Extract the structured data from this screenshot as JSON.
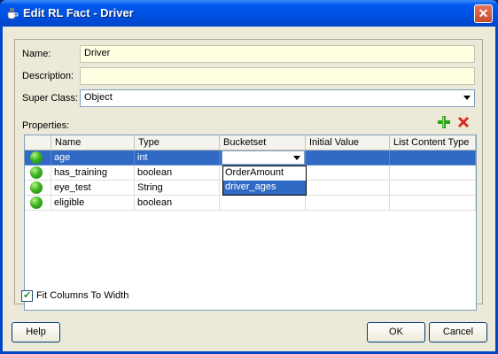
{
  "window": {
    "title": "Edit RL Fact - Driver",
    "close_glyph": "✕"
  },
  "form": {
    "name_label": "Name:",
    "name_value": "Driver",
    "description_label": "Description:",
    "description_value": "",
    "superclass_label": "Super Class:",
    "superclass_value": "Object",
    "properties_label": "Properties:"
  },
  "toolbar": {
    "add_icon": "add-icon",
    "delete_icon": "delete-icon"
  },
  "table": {
    "columns": [
      "Name",
      "Type",
      "Bucketset",
      "Initial Value",
      "List Content Type"
    ],
    "rows": [
      {
        "name": "age",
        "type": "int",
        "bucketset": "",
        "initial": "",
        "list_type": ""
      },
      {
        "name": "has_training",
        "type": "boolean",
        "bucketset": "",
        "initial": "",
        "list_type": ""
      },
      {
        "name": "eye_test",
        "type": "String",
        "bucketset": "",
        "initial": "",
        "list_type": ""
      },
      {
        "name": "eligible",
        "type": "boolean",
        "bucketset": "",
        "initial": "",
        "list_type": ""
      }
    ],
    "bucketset_options": [
      "OrderAmount",
      "driver_ages"
    ]
  },
  "fit_columns": {
    "label": "Fit Columns To Width",
    "checked": "✔"
  },
  "buttons": {
    "help": "Help",
    "ok": "OK",
    "cancel": "Cancel"
  },
  "colors": {
    "selection": "#316ac5",
    "dialog_bg": "#ece9d8",
    "titlebar": "#0058ee"
  }
}
